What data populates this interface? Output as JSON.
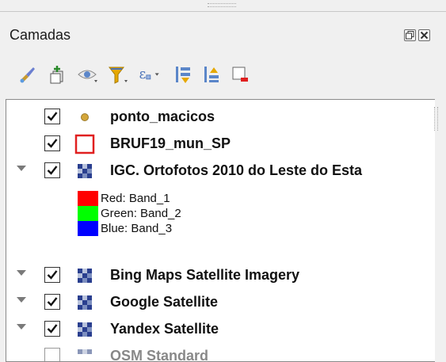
{
  "panel": {
    "title": "Camadas"
  },
  "toolbar": {
    "buttons": [
      {
        "icon": "style-brush-icon"
      },
      {
        "icon": "add-group-icon"
      },
      {
        "icon": "visibility-eye-icon"
      },
      {
        "icon": "filter-icon"
      },
      {
        "icon": "expression-filter-icon"
      },
      {
        "icon": "expand-all-icon"
      },
      {
        "icon": "collapse-all-icon"
      },
      {
        "icon": "remove-layer-icon"
      }
    ]
  },
  "layers": [
    {
      "name": "ponto_macicos",
      "checked": true,
      "type": "point"
    },
    {
      "name": "BRUF19_mun_SP",
      "checked": true,
      "type": "polygon"
    },
    {
      "name": "IGC. Ortofotos 2010 do Leste do Esta",
      "checked": true,
      "type": "raster",
      "expanded": true,
      "legend": [
        {
          "label": "Red:   Band_1",
          "color": "#ff0000"
        },
        {
          "label": "Green: Band_2",
          "color": "#00ff00"
        },
        {
          "label": "Blue:   Band_3",
          "color": "#0000ff"
        }
      ]
    },
    {
      "name": "Bing Maps Satellite Imagery",
      "checked": true,
      "type": "raster"
    },
    {
      "name": "Google Satellite",
      "checked": true,
      "type": "raster"
    },
    {
      "name": "Yandex Satellite",
      "checked": true,
      "type": "raster"
    },
    {
      "name": "OSM Standard",
      "checked": false,
      "type": "raster"
    }
  ],
  "colors": {
    "point": "#d4a63a",
    "polygon_outline": "#e02020",
    "accent_filter": "#e6a800"
  }
}
